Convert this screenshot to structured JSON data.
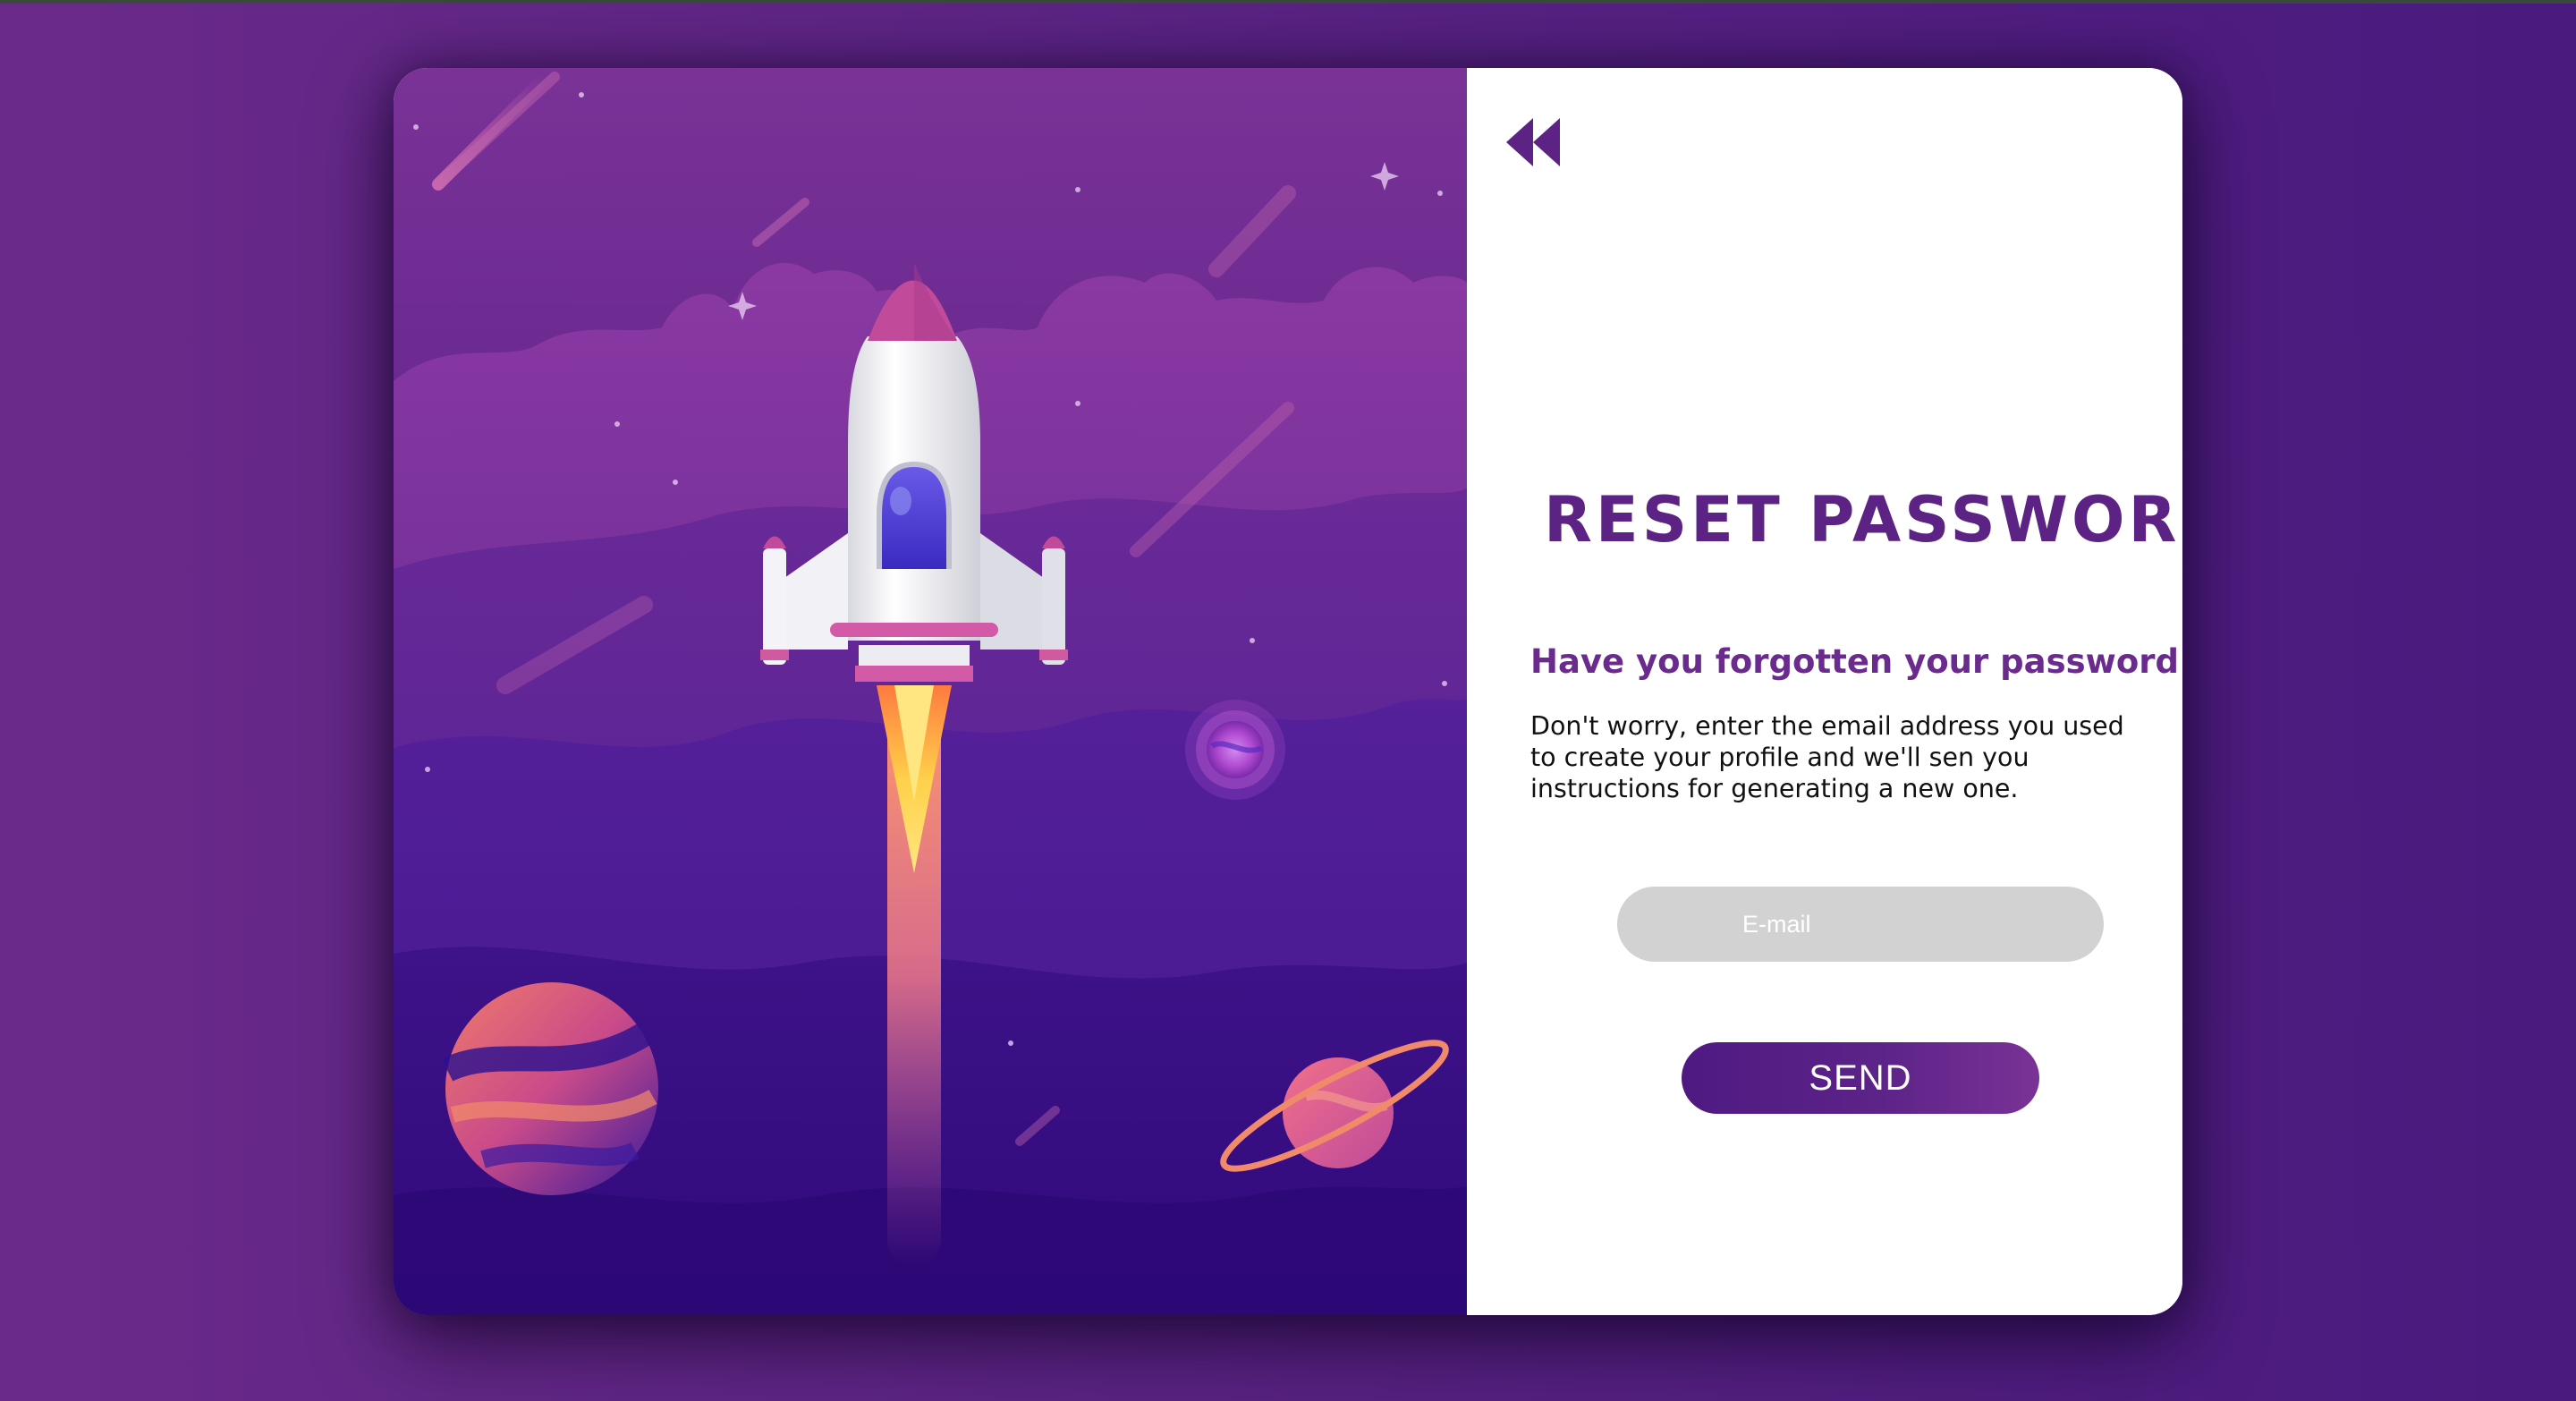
{
  "panel": {
    "title": "RESET PASSWORD",
    "subtitle": "Have you forgotten your password ?",
    "description": "Don't worry, enter the email address you used to create your profile and we'll sen you instructions for generating a new one.",
    "email_placeholder": "E-mail",
    "send_label": "SEND",
    "back_icon": "double-chevron-left-icon"
  },
  "colors": {
    "background": "#5c2385",
    "accent": "#5c2384",
    "input_bg": "#d2d2d2"
  },
  "illustration": {
    "subject": "rocket-launch-illustration",
    "icons": [
      "rocket-icon",
      "planet-icon",
      "ringed-planet-icon",
      "small-planet-icon",
      "star-icon",
      "meteor-icon",
      "cloud-icon"
    ]
  }
}
